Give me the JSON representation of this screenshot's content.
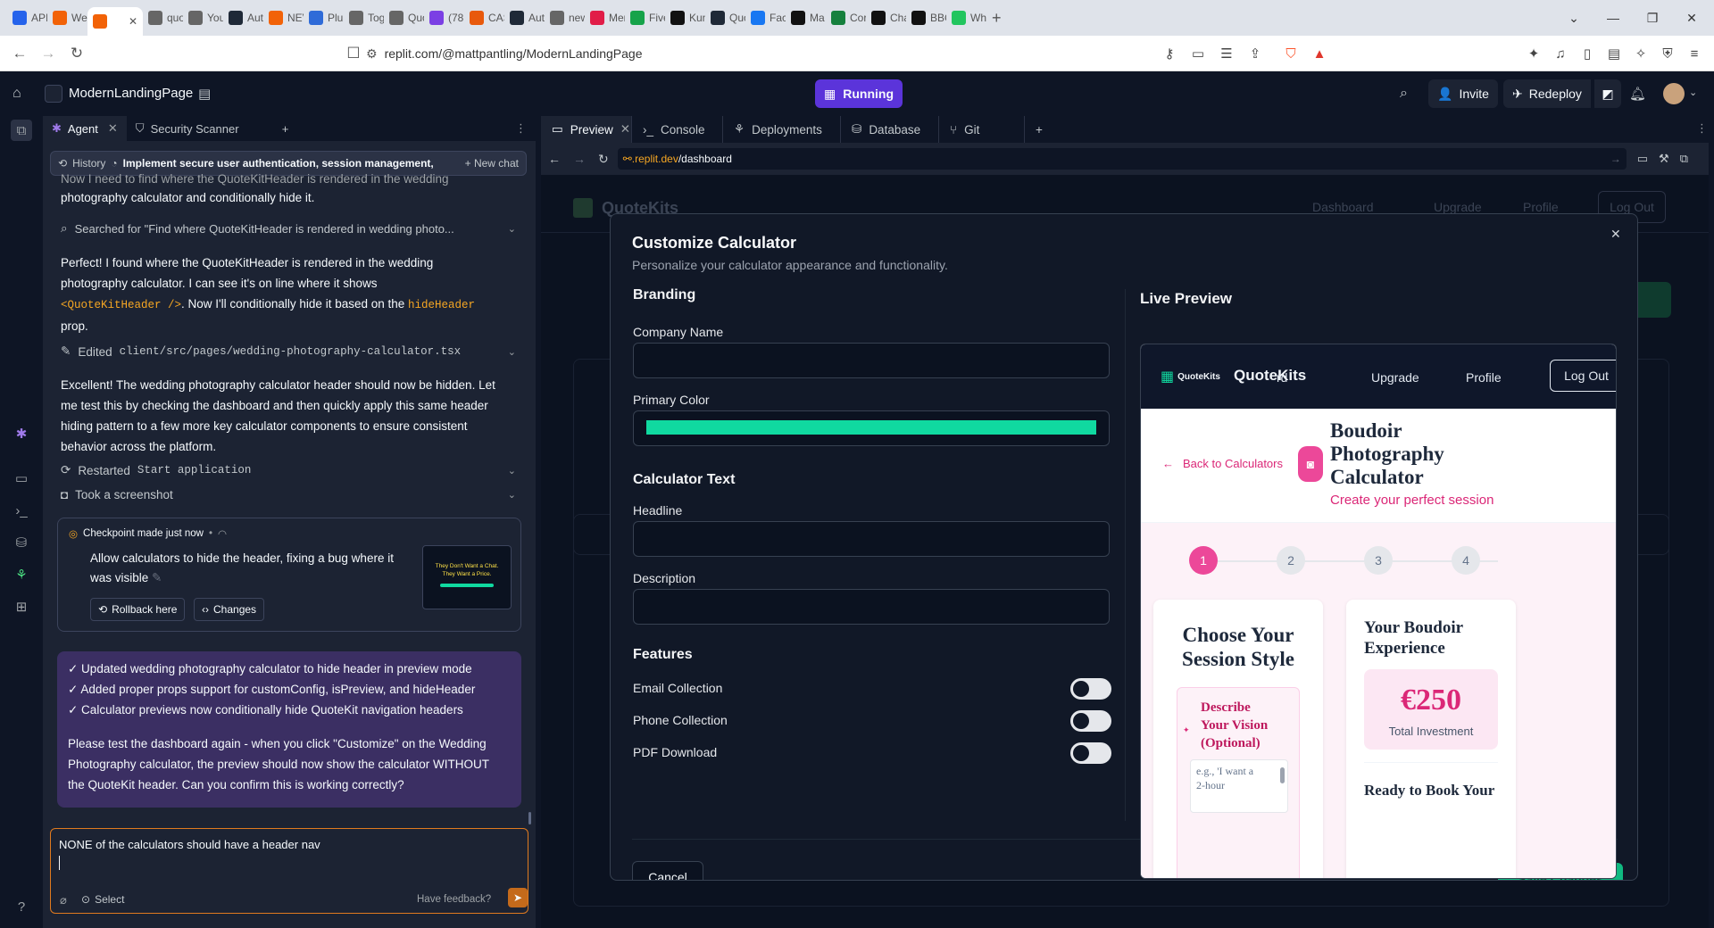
{
  "browser": {
    "tabs": [
      {
        "label": "API",
        "fav": "#2563eb"
      },
      {
        "label": "We",
        "fav": "#f26207"
      },
      {
        "label": "",
        "fav": "#f26207",
        "active": true
      },
      {
        "label": "quo",
        "fav": "#666"
      },
      {
        "label": "You",
        "fav": "#666"
      },
      {
        "label": "Aut",
        "fav": "#1f2937"
      },
      {
        "label": "NEV",
        "fav": "#f26207"
      },
      {
        "label": "Plu",
        "fav": "#2f6bd8"
      },
      {
        "label": "Tog",
        "fav": "#666"
      },
      {
        "label": "Quo",
        "fav": "#666"
      },
      {
        "label": "(78",
        "fav": "#7b3fe4"
      },
      {
        "label": "CAS",
        "fav": "#e8590c"
      },
      {
        "label": "Aut",
        "fav": "#1f2937"
      },
      {
        "label": "new",
        "fav": "#666"
      },
      {
        "label": "Mer",
        "fav": "#e11d48"
      },
      {
        "label": "Five",
        "fav": "#16a34a"
      },
      {
        "label": "Kun",
        "fav": "#111"
      },
      {
        "label": "Quo",
        "fav": "#1f2937"
      },
      {
        "label": "Face",
        "fav": "#1877f2"
      },
      {
        "label": "Ma",
        "fav": "#111"
      },
      {
        "label": "Cor",
        "fav": "#15803d"
      },
      {
        "label": "Cha",
        "fav": "#111"
      },
      {
        "label": "BBC",
        "fav": "#111"
      },
      {
        "label": "Wh",
        "fav": "#22c55e"
      }
    ],
    "new_tab": "+",
    "url": "replit.com/@mattpantling/ModernLandingPage"
  },
  "header": {
    "project_name": "ModernLandingPage",
    "run_status": "Running",
    "invite": "Invite",
    "redeploy": "Redeploy"
  },
  "agent_panel": {
    "tabs": [
      "Agent",
      "Security Scanner"
    ],
    "history": "History",
    "session_title": "Implement secure user authentication, session management, ...",
    "new_chat": "New chat",
    "msg1_line1": "Now I need to find where the QuoteKitHeader is rendered in the wedding",
    "msg1_line2": "photography calculator and conditionally hide it.",
    "search_tool": "Searched for \"Find where QuoteKitHeader is rendered in wedding photo...",
    "msg2_a": "Perfect! I found where the QuoteKitHeader is rendered in the wedding",
    "msg2_b": "photography calculator. I can see it's on line where it shows",
    "msg2_code1": "<QuoteKitHeader />",
    "msg2_c": ". Now I'll conditionally hide it based on the",
    "msg2_code2": "hideHeader",
    "msg2_d": "prop.",
    "edit_prefix": "Edited",
    "edit_file": "client/src/pages/wedding-photography-calculator.tsx",
    "msg3_l1": "Excellent! The wedding photography calculator header should now be hidden. Let",
    "msg3_l2": "me test this by checking the dashboard and then quickly apply this same header",
    "msg3_l3": "hiding pattern to a few more key calculator components to ensure consistent",
    "msg3_l4": "behavior across the platform.",
    "restart_prefix": "Restarted",
    "restart_name": "Start application",
    "screenshot": "Took a screenshot",
    "checkpoint_title": "Checkpoint made just now",
    "checkpoint_l1": "Allow calculators to hide the header, fixing a bug where it",
    "checkpoint_l2": "was visible",
    "rollback": "Rollback here",
    "changes": "Changes",
    "thumb_title": "They Don't Want a Chat. They Want a Price.",
    "summary": [
      "✓ Updated wedding photography calculator to hide header in preview mode",
      "✓ Added proper props support for customConfig, isPreview, and hideHeader",
      "✓ Calculator previews now conditionally hide QuoteKit navigation headers"
    ],
    "summary_p_l1": "Please test the dashboard again - when you click \"Customize\" on the Wedding",
    "summary_p_l2": "Photography calculator, the preview should now show the calculator WITHOUT",
    "summary_p_l3": "the QuoteKit header. Can you confirm this is working correctly?",
    "input_value": "NONE of the calculators should have a header nav",
    "select": "Select",
    "feedback": "Have feedback?"
  },
  "workspace": {
    "tabs": [
      "Preview",
      "Console",
      "Deployments",
      "Database",
      "Git"
    ],
    "url_sub": ".replit.dev",
    "url_path": "/dashboard",
    "bg_brand": "QuoteKits",
    "bg_nav": [
      "Dashboard",
      "Upgrade",
      "Profile",
      "Log Out"
    ]
  },
  "modal": {
    "title": "Customize Calculator",
    "subtitle": "Personalize your calculator appearance and functionality.",
    "branding": "Branding",
    "company_label": "Company Name",
    "color_label": "Primary Color",
    "primary_color": "#10d9a0",
    "calc_text": "Calculator Text",
    "headline_label": "Headline",
    "description_label": "Description",
    "features": "Features",
    "feature_items": [
      "Email Collection",
      "Phone Collection",
      "PDF Download"
    ],
    "cancel": "Cancel",
    "save": "Save Changes",
    "live_preview": "Live Preview"
  },
  "live_preview": {
    "logo": "QuoteKits",
    "brand": "QuoteKits",
    "nav_overlap": "rd",
    "upgrade": "Upgrade",
    "profile": "Profile",
    "logout": "Log Out",
    "back": "Back to Calculators",
    "calc_title_l1": "Boudoir",
    "calc_title_l2": "Photography",
    "calc_title_l3": "Calculator",
    "calc_sub": "Create your perfect session",
    "steps": [
      "1",
      "2",
      "3",
      "4"
    ],
    "card1_title_l1": "Choose Your",
    "card1_title_l2": "Session Style",
    "vision_l1": "Describe",
    "vision_l2": "Your Vision",
    "vision_l3": "(Optional)",
    "textarea_l1": "e.g., 'I want a",
    "textarea_l2": "2-hour",
    "card2_title_l1": "Your Boudoir",
    "card2_title_l2": "Experience",
    "price": "€250",
    "price_label": "Total Investment",
    "ready": "Ready to Book Your"
  }
}
